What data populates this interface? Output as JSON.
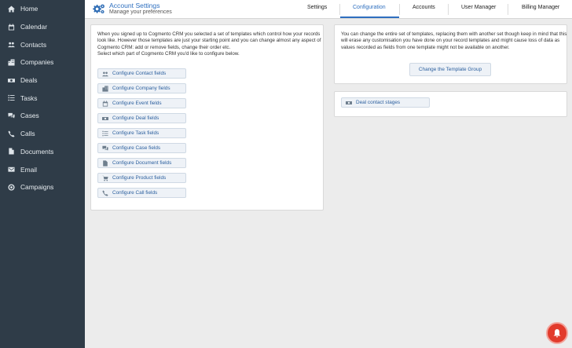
{
  "sidebar": {
    "items": [
      {
        "label": "Home",
        "icon": "home-icon"
      },
      {
        "label": "Calendar",
        "icon": "calendar-icon"
      },
      {
        "label": "Contacts",
        "icon": "contacts-icon"
      },
      {
        "label": "Companies",
        "icon": "companies-icon"
      },
      {
        "label": "Deals",
        "icon": "deals-icon"
      },
      {
        "label": "Tasks",
        "icon": "tasks-icon"
      },
      {
        "label": "Cases",
        "icon": "cases-icon"
      },
      {
        "label": "Calls",
        "icon": "phone-icon"
      },
      {
        "label": "Documents",
        "icon": "document-icon"
      },
      {
        "label": "Email",
        "icon": "email-icon"
      },
      {
        "label": "Campaigns",
        "icon": "campaigns-icon"
      }
    ]
  },
  "header": {
    "title": "Account Settings",
    "subtitle": "Manage your preferences",
    "tabs": [
      {
        "label": "Settings"
      },
      {
        "label": "Configuration",
        "active": true
      },
      {
        "label": "Accounts"
      },
      {
        "label": "User Manager"
      },
      {
        "label": "Billing Manager"
      }
    ]
  },
  "left_panel": {
    "intro": "When you signed up to Cogmento CRM you selected a set of templates which control how your records look like. However those templates are just your starting point and you can change almost any aspect of Cogmento CRM: add or remove fields, change their order etc.",
    "prompt": "Select which part of Cogmento CRM you'd like to configure below.",
    "buttons": [
      {
        "label": "Configure Contact fields",
        "icon": "contacts-icon"
      },
      {
        "label": "Configure Company fields",
        "icon": "companies-icon"
      },
      {
        "label": "Configure Event fields",
        "icon": "calendar-icon"
      },
      {
        "label": "Configure Deal fields",
        "icon": "deals-icon"
      },
      {
        "label": "Configure Task fields",
        "icon": "tasks-icon"
      },
      {
        "label": "Configure Case fields",
        "icon": "cases-icon"
      },
      {
        "label": "Configure Document fields",
        "icon": "document-icon"
      },
      {
        "label": "Configure Product fields",
        "icon": "cart-icon"
      },
      {
        "label": "Configure Call fields",
        "icon": "phone-icon"
      }
    ]
  },
  "right_panel": {
    "text": "You can change the entire set of templates, replacing them with another set though keep in mind that this will erase any customisation you have done on your record templates and might cause loss of data as values recorded as fields from one template might not be available on another.",
    "button": "Change the Template Group"
  },
  "stages_panel": {
    "button": "Deal contact stages",
    "icon": "deals-icon"
  },
  "colors": {
    "sidebar_bg": "#2f3c48",
    "accent": "#2e6fbf",
    "notification": "#e23b2c"
  }
}
